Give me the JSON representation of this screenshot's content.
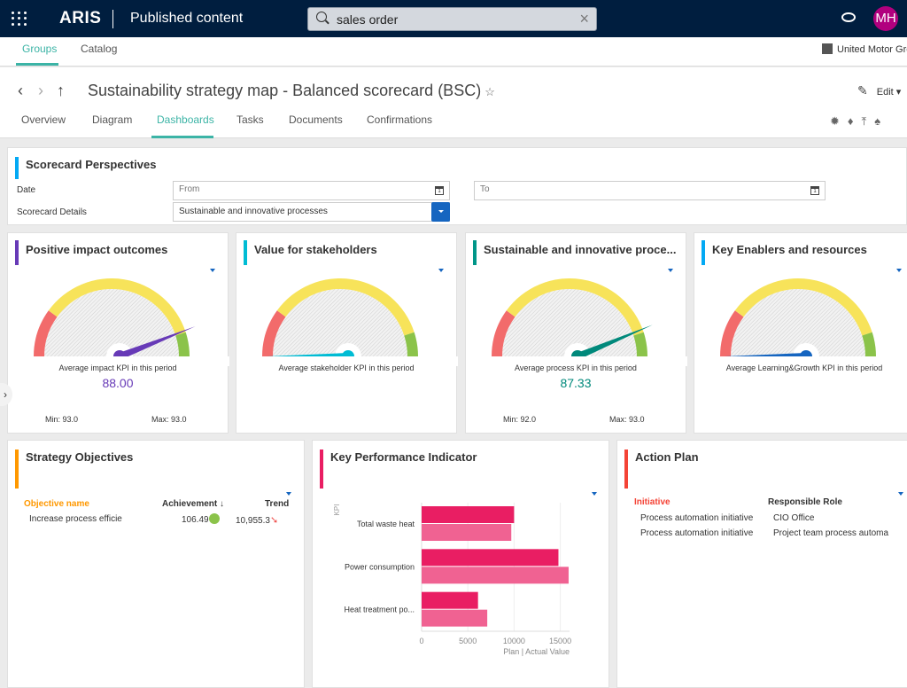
{
  "topbar": {
    "logo": "ARIS",
    "app_title": "Published content",
    "search_value": "sales order",
    "clear_icon": "×",
    "avatar_initials": "MH"
  },
  "subnav": {
    "tabs": [
      {
        "label": "Groups",
        "active": true
      },
      {
        "label": "Catalog",
        "active": false
      }
    ],
    "org": "United Motor Gro"
  },
  "header": {
    "back": "‹",
    "forward": "›",
    "up": "↑",
    "title": "Sustainability strategy map - Balanced scorecard (BSC)",
    "star": "☆",
    "edit_label": "Edit ▾",
    "tabs": [
      "Overview",
      "Diagram",
      "Dashboards",
      "Tasks",
      "Documents",
      "Confirmations"
    ],
    "active_tab": "Dashboards"
  },
  "perspectives": {
    "title": "Scorecard Perspectives",
    "date_label": "Date",
    "from_placeholder": "From",
    "to_placeholder": "To",
    "details_label": "Scorecard Details",
    "details_value": "Sustainable and innovative processes"
  },
  "gauges": [
    {
      "title": "Positive impact outcomes",
      "accent": "#673ab7",
      "needle_color": "#673ab7",
      "label": "Average impact KPI in this period",
      "value": "88.00",
      "value_fraction": 0.88,
      "min": "Min: 93.0",
      "max": "Max: 93.0"
    },
    {
      "title": "Value for stakeholders",
      "accent": "#00bcd4",
      "needle_color": "#00bcd4",
      "label": "Average stakeholder KPI in this period",
      "value": "",
      "value_fraction": 0.0,
      "min": "",
      "max": ""
    },
    {
      "title": "Sustainable and innovative proce...",
      "accent": "#009688",
      "needle_color": "#00897b",
      "label": "Average process KPI in this period",
      "value": "87.33",
      "value_fraction": 0.8733,
      "min": "Min: 92.0",
      "max": "Max: 93.0"
    },
    {
      "title": "Key Enablers and resources",
      "accent": "#03a9f4",
      "needle_color": "#1565c0",
      "label": "Average Learning&Growth KPI in this period",
      "value": "",
      "value_fraction": 0.0,
      "min": "",
      "max": ""
    }
  ],
  "gauge_bands": {
    "red": "#f26b6b",
    "yellow": "#f7e35a",
    "green": "#8bc34a",
    "red_to": 0.2,
    "yellow_to": 0.9
  },
  "objectives": {
    "title": "Strategy Objectives",
    "columns": [
      "Objective name",
      "Achievement ↓",
      "Trend"
    ],
    "rows": [
      {
        "name": "Increase process efficie",
        "achievement": "106.49",
        "trend": "10,955.3"
      }
    ]
  },
  "kpi": {
    "title": "Key Performance Indicator",
    "y_axis_label": "KPI"
  },
  "chart_data": {
    "type": "bar",
    "orientation": "horizontal",
    "title": "Key Performance Indicator",
    "categories": [
      "Total waste heat",
      "Power consumption",
      "Heat treatment po..."
    ],
    "series": [
      {
        "name": "Plan",
        "color": "#e91e63",
        "values": [
          10000,
          14800,
          6100
        ]
      },
      {
        "name": "Actual Value",
        "color": "#f06292",
        "values": [
          9700,
          15900,
          7100
        ]
      }
    ],
    "xlabel": "Plan | Actual Value",
    "ylabel": "KPI",
    "xlim": [
      0,
      16000
    ],
    "xticks": [
      0,
      5000,
      10000,
      15000
    ],
    "grid": true
  },
  "action_plan": {
    "title": "Action Plan",
    "columns": [
      "Initiative",
      "Responsible Role"
    ],
    "rows": [
      {
        "initiative": "Process automation initiative",
        "role": "CIO Office"
      },
      {
        "initiative": "Process automation initiative",
        "role": "Project team process automa"
      }
    ]
  }
}
